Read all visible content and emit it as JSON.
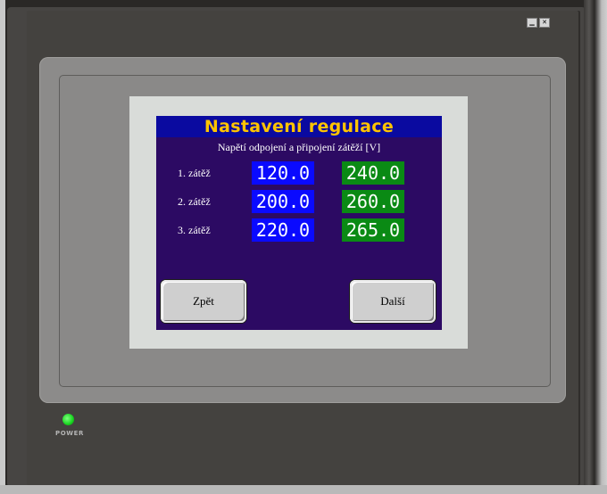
{
  "window": {
    "minimize_glyph": "▁",
    "close_glyph": "✕"
  },
  "screen": {
    "title": "Nastavení regulace",
    "subtitle": "Napětí odpojení a připojení zátěží [V]",
    "rows": [
      {
        "label": "1. zátěž",
        "disconnect": "120.0",
        "connect": "240.0"
      },
      {
        "label": "2. zátěž",
        "disconnect": "200.0",
        "connect": "260.0"
      },
      {
        "label": "3. zátěž",
        "disconnect": "220.0",
        "connect": "265.0"
      }
    ],
    "back_button": "Zpět",
    "next_button": "Další"
  },
  "device": {
    "power_label": "POWER"
  },
  "colors": {
    "screen_bg": "#2c0a63",
    "title_bar": "#0a0aa0",
    "title_text": "#ffc400",
    "disconnect_value_bg": "#0a0aff",
    "connect_value_bg": "#0a8a14",
    "power_led": "#17d41f"
  }
}
